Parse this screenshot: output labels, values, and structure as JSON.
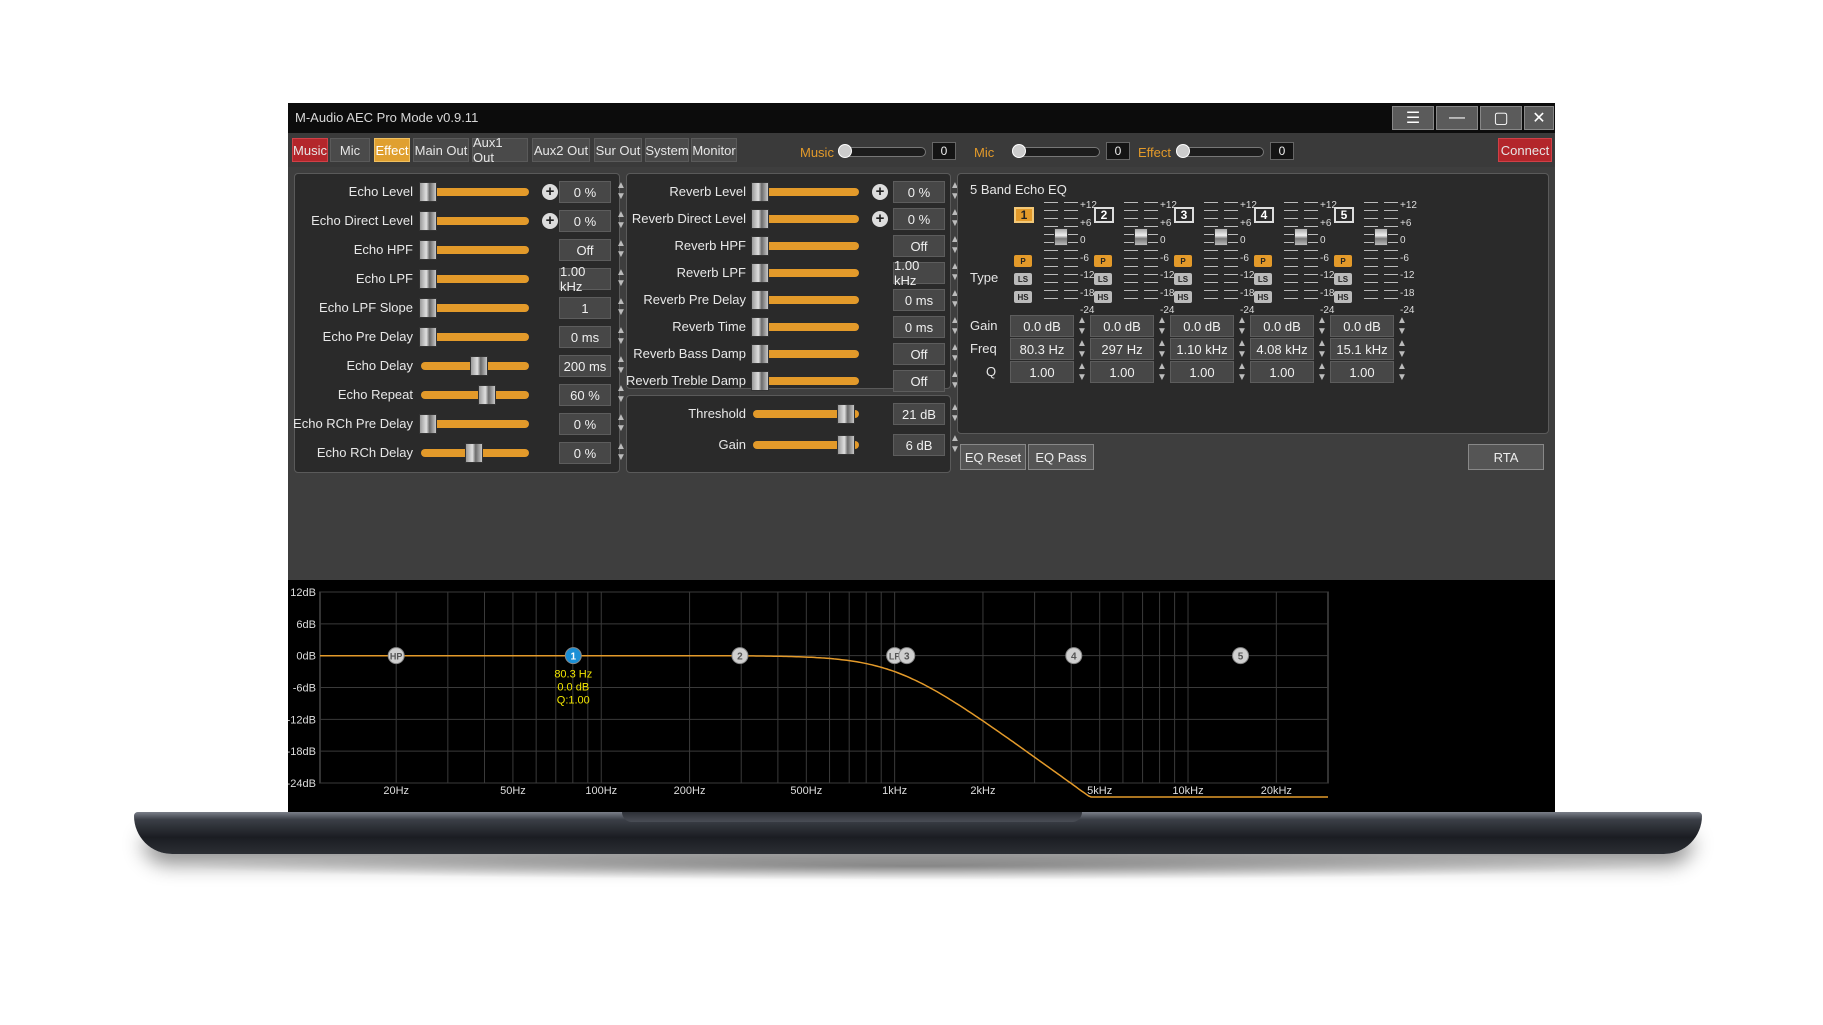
{
  "window": {
    "title": "M-Audio AEC Pro Mode v0.9.11"
  },
  "tabs": [
    {
      "label": "Music",
      "style": "red"
    },
    {
      "label": "Mic",
      "style": "normal"
    },
    {
      "label": "Effect",
      "style": "orange"
    },
    {
      "label": "Main Out",
      "style": "normal"
    },
    {
      "label": "Aux1 Out",
      "style": "normal"
    },
    {
      "label": "Aux2 Out",
      "style": "normal"
    },
    {
      "label": "Sur Out",
      "style": "normal"
    },
    {
      "label": "System",
      "style": "normal"
    },
    {
      "label": "Monitor",
      "style": "normal"
    }
  ],
  "mini_sliders": [
    {
      "label": "Music",
      "value": "0",
      "level": 0
    },
    {
      "label": "Mic",
      "value": "0",
      "level": 0
    },
    {
      "label": "Effect",
      "value": "0",
      "level": 0
    }
  ],
  "connect_label": "Connect",
  "echo": {
    "rows": [
      {
        "label": "Echo Level",
        "value": "0 %",
        "level": 0.0,
        "plus": true
      },
      {
        "label": "Echo Direct Level",
        "value": "0 %",
        "level": 0.0,
        "plus": true
      },
      {
        "label": "Echo HPF",
        "value": "Off",
        "level": 0.0,
        "plus": false
      },
      {
        "label": "Echo LPF",
        "value": "1.00 kHz",
        "level": 0.0,
        "plus": false
      },
      {
        "label": "Echo LPF Slope",
        "value": "1",
        "level": 0.0,
        "plus": false
      },
      {
        "label": "Echo Pre Delay",
        "value": "0 ms",
        "level": 0.0,
        "plus": false
      },
      {
        "label": "Echo Delay",
        "value": "200 ms",
        "level": 0.55,
        "plus": false
      },
      {
        "label": "Echo Repeat",
        "value": "60 %",
        "level": 0.64,
        "plus": false
      },
      {
        "label": "Echo RCh Pre Delay",
        "value": "0 %",
        "level": 0.0,
        "plus": false
      },
      {
        "label": "Echo RCh Delay",
        "value": "0 %",
        "level": 0.5,
        "plus": false
      }
    ]
  },
  "reverb": {
    "rows": [
      {
        "label": "Reverb Level",
        "value": "0 %",
        "level": 0.0,
        "plus": true
      },
      {
        "label": "Reverb Direct Level",
        "value": "0 %",
        "level": 0.0,
        "plus": true
      },
      {
        "label": "Reverb HPF",
        "value": "Off",
        "level": 0.0,
        "plus": false
      },
      {
        "label": "Reverb LPF",
        "value": "1.00 kHz",
        "level": 0.0,
        "plus": false
      },
      {
        "label": "Reverb Pre Delay",
        "value": "0 ms",
        "level": 0.0,
        "plus": false
      },
      {
        "label": "Reverb Time",
        "value": "0 ms",
        "level": 0.0,
        "plus": false
      },
      {
        "label": "Reverb Bass Damp",
        "value": "Off",
        "level": 0.0,
        "plus": false
      },
      {
        "label": "Reverb Treble Damp",
        "value": "Off",
        "level": 0.0,
        "plus": false
      }
    ]
  },
  "dynamics": {
    "rows": [
      {
        "label": "Threshold",
        "value": "21 dB",
        "level": 0.95
      },
      {
        "label": "Gain",
        "value": "6 dB",
        "level": 0.95
      }
    ]
  },
  "eq": {
    "title": "5 Band Echo EQ",
    "type_label": "Type",
    "gain_label": "Gain",
    "freq_label": "Freq",
    "q_label": "Q",
    "scale": [
      "+12",
      "+6",
      "0",
      "-6",
      "-12",
      "-18",
      "-24"
    ],
    "type_buttons": [
      "P",
      "LS",
      "HS"
    ],
    "bands": [
      {
        "num": "1",
        "selected": true,
        "gain": "0.0 dB",
        "freq": "80.3 Hz",
        "q": "1.00"
      },
      {
        "num": "2",
        "selected": false,
        "gain": "0.0 dB",
        "freq": "297 Hz",
        "q": "1.00"
      },
      {
        "num": "3",
        "selected": false,
        "gain": "0.0 dB",
        "freq": "1.10 kHz",
        "q": "1.00"
      },
      {
        "num": "4",
        "selected": false,
        "gain": "0.0 dB",
        "freq": "4.08 kHz",
        "q": "1.00"
      },
      {
        "num": "5",
        "selected": false,
        "gain": "0.0 dB",
        "freq": "15.1 kHz",
        "q": "1.00"
      }
    ],
    "reset_label": "EQ Reset",
    "pass_label": "EQ Pass",
    "rta_label": "RTA"
  },
  "graph": {
    "y_ticks": [
      "12dB",
      "6dB",
      "0dB",
      "-6dB",
      "-12dB",
      "-18dB",
      "-24dB"
    ],
    "y_values": [
      12,
      6,
      0,
      -6,
      -12,
      -18,
      -24
    ],
    "x_ticks": [
      "20Hz",
      "50Hz",
      "100Hz",
      "200Hz",
      "500Hz",
      "1kHz",
      "2kHz",
      "5kHz",
      "10kHz",
      "20kHz"
    ],
    "x_values": [
      20,
      50,
      100,
      200,
      500,
      1000,
      2000,
      5000,
      10000,
      20000
    ],
    "x_range_hz": [
      11,
      30000
    ],
    "y_range_db": [
      -24,
      12
    ],
    "curve_color": "#e39a2a",
    "lowpass_cutoff_hz": 1000,
    "nodes": [
      {
        "label": "HP",
        "freq_hz": 20,
        "gain_db": 0,
        "selected": false
      },
      {
        "label": "1",
        "freq_hz": 80.3,
        "gain_db": 0,
        "selected": true
      },
      {
        "label": "2",
        "freq_hz": 297,
        "gain_db": 0,
        "selected": false
      },
      {
        "label": "LP",
        "freq_hz": 1000,
        "gain_db": 0,
        "selected": false
      },
      {
        "label": "3",
        "freq_hz": 1100,
        "gain_db": 0,
        "selected": false
      },
      {
        "label": "4",
        "freq_hz": 4080,
        "gain_db": 0,
        "selected": false
      },
      {
        "label": "5",
        "freq_hz": 15100,
        "gain_db": 0,
        "selected": false
      }
    ],
    "selected_readout": [
      "80.3 Hz",
      "0.0 dB",
      "Q:1.00"
    ]
  },
  "colors": {
    "accent": "#e39a2a",
    "red": "#b3262b",
    "node_selected": "#1a8fd6",
    "readout": "#f2e600"
  }
}
